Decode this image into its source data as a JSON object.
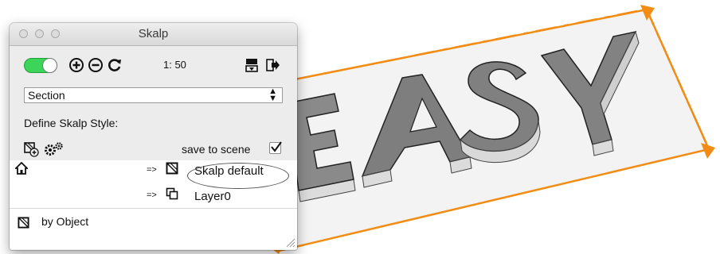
{
  "window": {
    "title": "Skalp"
  },
  "toolbar": {
    "scale_label": "1: 50",
    "toggle_state": "on",
    "icons": [
      "add-icon",
      "remove-icon",
      "refresh-icon",
      "layer-stack-icon",
      "export-icon"
    ]
  },
  "section_select": {
    "selected": "Section"
  },
  "style": {
    "define_label": "Define Skalp Style:",
    "save_to_scene_label": "save to scene",
    "save_to_scene_checked": true
  },
  "mapping": {
    "rows": [
      {
        "arrow": "=>",
        "value": "Skalp default",
        "icon": "hatch-pattern-icon"
      },
      {
        "arrow": "=>",
        "value": "Layer0",
        "icon": "layers-icon"
      }
    ],
    "by_object_label": "by Object"
  },
  "scene": {
    "text": "EASY",
    "accent_color": "#f28c14"
  }
}
